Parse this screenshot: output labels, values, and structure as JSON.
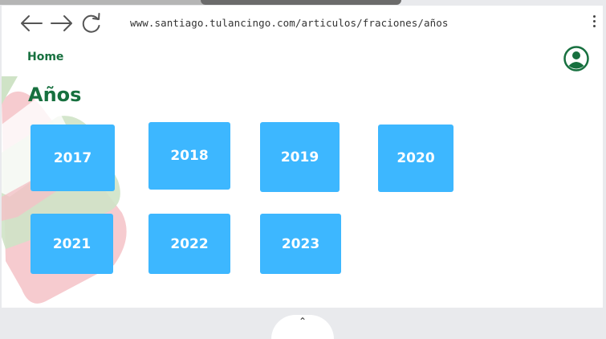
{
  "browser": {
    "url": "www.santiago.tulancingo.com/articulos/fraciones/años",
    "back_icon": "arrow-left-icon",
    "forward_icon": "arrow-right-icon",
    "reload_icon": "reload-icon",
    "menu_icon": "kebab-menu-icon"
  },
  "nav": {
    "home_label": "Home",
    "account_icon": "account-circle-icon"
  },
  "main": {
    "title": "Años",
    "years": [
      "2017",
      "2018",
      "2019",
      "2020",
      "2021",
      "2022",
      "2023"
    ]
  },
  "colors": {
    "brand_green": "#17703f",
    "tile_blue": "#3db7ff",
    "decor_pink": "#f4c2c7",
    "decor_green": "#cfe3c6"
  },
  "bottom_handle": {
    "icon": "chevron-up-icon",
    "label": "⌃"
  }
}
